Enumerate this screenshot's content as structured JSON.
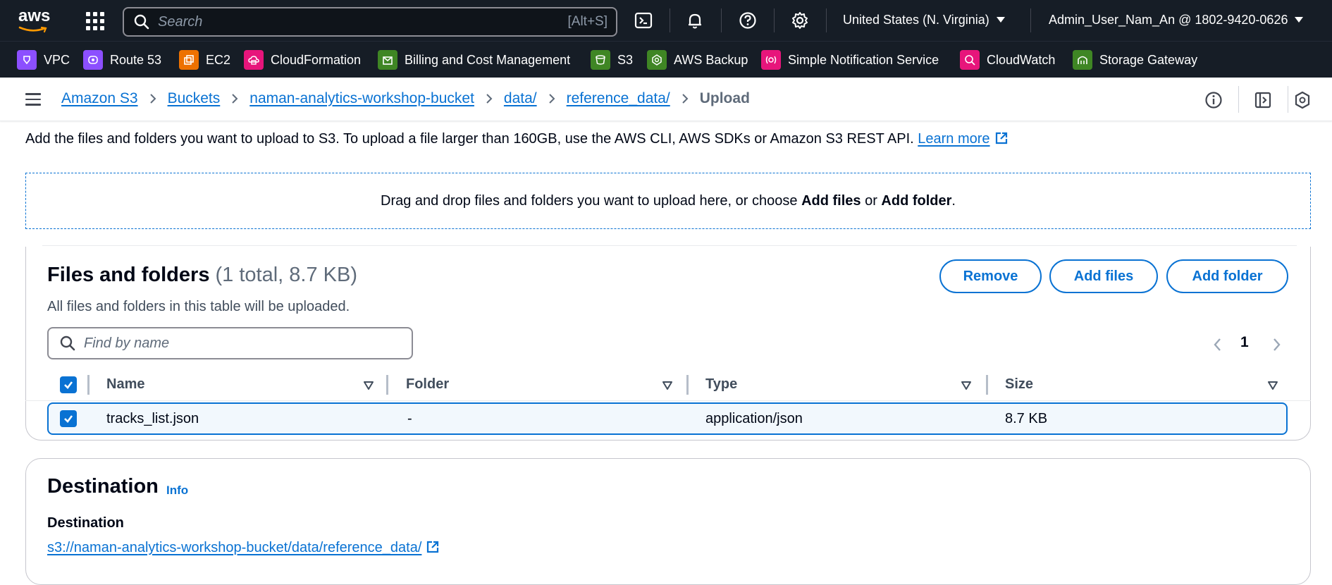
{
  "topnav": {
    "logo": "aws",
    "search_placeholder": "Search",
    "search_shortcut": "[Alt+S]",
    "region": "United States (N. Virginia)",
    "account": "Admin_User_Nam_An @ 1802-9420-0626"
  },
  "favorites": [
    {
      "label": "VPC",
      "icon": "vpc-icon",
      "color": "#8c4fff"
    },
    {
      "label": "Route 53",
      "icon": "route53-icon",
      "color": "#8c4fff"
    },
    {
      "label": "EC2",
      "icon": "ec2-icon",
      "color": "#ed7100"
    },
    {
      "label": "CloudFormation",
      "icon": "cloudformation-icon",
      "color": "#e7157b"
    },
    {
      "label": "Billing and Cost Management",
      "icon": "billing-icon",
      "color": "#3f8624"
    },
    {
      "label": "S3",
      "icon": "s3-icon",
      "color": "#3f8624"
    },
    {
      "label": "AWS Backup",
      "icon": "backup-icon",
      "color": "#3f8624"
    },
    {
      "label": "Simple Notification Service",
      "icon": "sns-icon",
      "color": "#e7157b"
    },
    {
      "label": "CloudWatch",
      "icon": "cloudwatch-icon",
      "color": "#e7157b"
    },
    {
      "label": "Storage Gateway",
      "icon": "storage-gateway-icon",
      "color": "#3f8624"
    }
  ],
  "breadcrumb": {
    "items": [
      "Amazon S3",
      "Buckets",
      "naman-analytics-workshop-bucket",
      "data/",
      "reference_data/"
    ],
    "current": "Upload"
  },
  "intro": {
    "text": "Add the files and folders you want to upload to S3. To upload a file larger than 160GB, use the AWS CLI, AWS SDKs or Amazon S3 REST API.",
    "link": "Learn more"
  },
  "dropzone": {
    "prefix": "Drag and drop files and folders you want to upload here, or choose ",
    "add_files": "Add files",
    "or": " or ",
    "add_folder": "Add folder",
    "suffix": "."
  },
  "files": {
    "title": "Files and folders",
    "count": "(1 total, 8.7 KB)",
    "description": "All files and folders in this table will be uploaded.",
    "remove_label": "Remove",
    "add_files_label": "Add files",
    "add_folder_label": "Add folder",
    "find_placeholder": "Find by name",
    "page": "1",
    "columns": [
      "Name",
      "Folder",
      "Type",
      "Size"
    ],
    "rows": [
      {
        "name": "tracks_list.json",
        "folder": "-",
        "type": "application/json",
        "size": "8.7 KB",
        "selected": true
      }
    ]
  },
  "destination": {
    "title": "Destination",
    "info": "Info",
    "label": "Destination",
    "path": "s3://naman-analytics-workshop-bucket/data/reference_data/"
  },
  "colors": {
    "nav_bg": "#161d26",
    "link": "#0972d3",
    "text": "#000716"
  }
}
